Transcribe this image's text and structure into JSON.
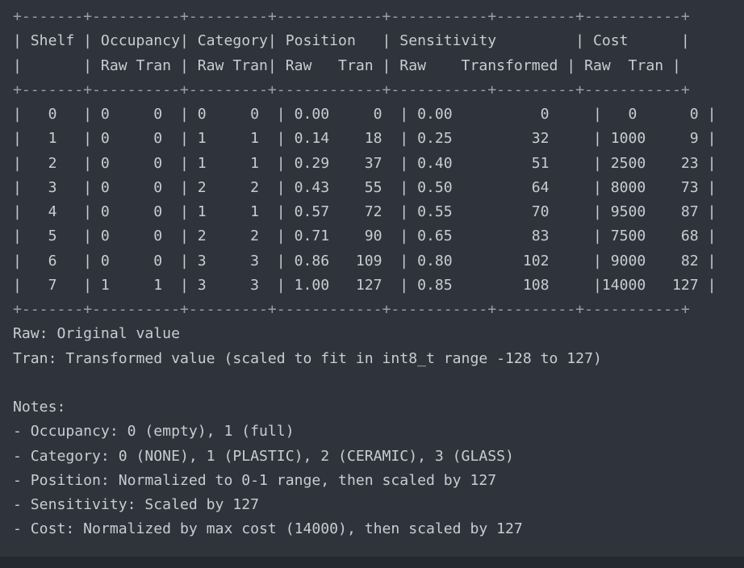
{
  "table": {
    "top_border": "+-------+----------+---------+------------+-----------+---------+-----------+",
    "header_row_1": "| Shelf | Occupancy| Category| Position   | Sensitivity         | Cost      |",
    "header_row_2": "|       | Raw Tran | Raw Tran| Raw   Tran | Raw    Transformed | Raw  Tran |",
    "header_divider": "+-------+----------+---------+------------+-----------+---------+-----------+",
    "rows": [
      "|   0   | 0     0  | 0     0  | 0.00     0  | 0.00          0     |   0      0 |",
      "|   1   | 0     0  | 1     1  | 0.14    18  | 0.25         32     | 1000     9 |",
      "|   2   | 0     0  | 1     1  | 0.29    37  | 0.40         51     | 2500    23 |",
      "|   3   | 0     0  | 2     2  | 0.43    55  | 0.50         64     | 8000    73 |",
      "|   4   | 0     0  | 1     1  | 0.57    72  | 0.55         70     | 9500    87 |",
      "|   5   | 0     0  | 2     2  | 0.71    90  | 0.65         83     | 7500    68 |",
      "|   6   | 0     0  | 3     3  | 0.86   109  | 0.80        102     | 9000    82 |",
      "|   7   | 1     1  | 3     3  | 1.00   127  | 0.85        108     |14000   127 |"
    ],
    "bottom_border": "+-------+----------+---------+------------+-----------+---------+-----------+"
  },
  "legend": {
    "raw": "Raw: Original value",
    "tran": "Tran: Transformed value (scaled to fit in int8_t range -128 to 127)"
  },
  "notes": {
    "title": "Notes:",
    "items": [
      "- Occupancy: 0 (empty), 1 (full)",
      "- Category: 0 (NONE), 1 (PLASTIC), 2 (CERAMIC), 3 (GLASS)",
      "- Position: Normalized to 0-1 range, then scaled by 127",
      "- Sensitivity: Scaled by 127",
      "- Cost: Normalized by max cost (14000), then scaled by 127"
    ]
  }
}
